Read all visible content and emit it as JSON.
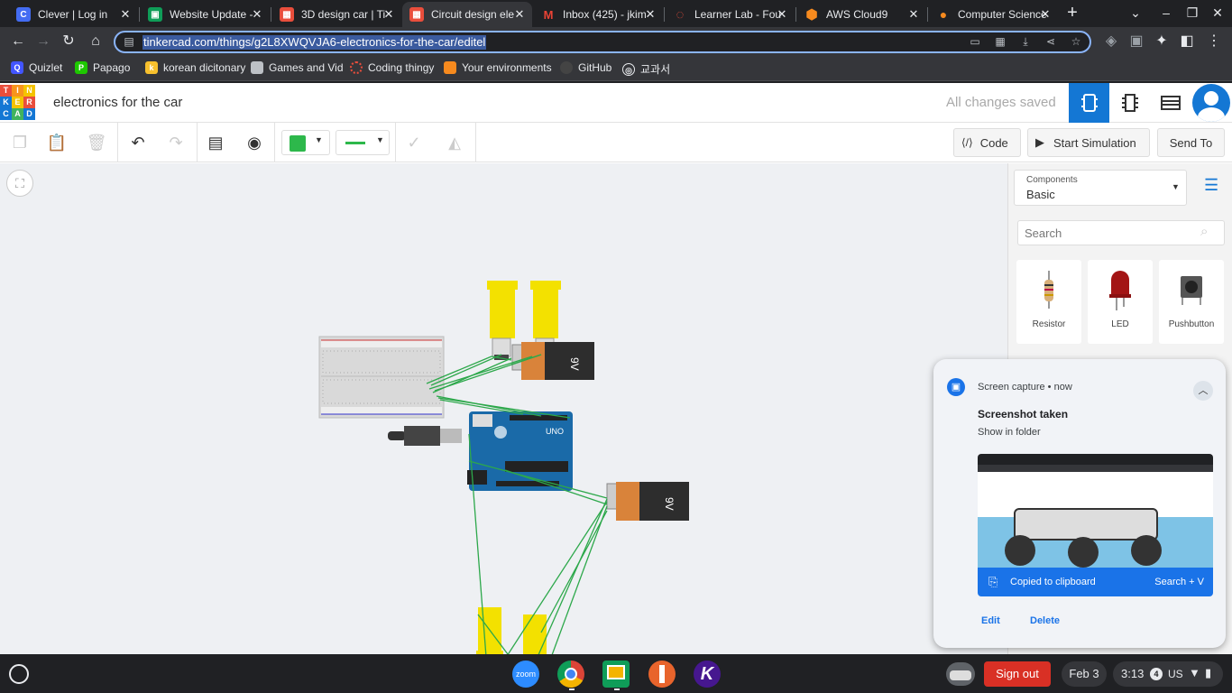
{
  "tabs": [
    {
      "title": "Clever | Log in",
      "fav": "C",
      "color": "#436cf2"
    },
    {
      "title": "Website Update - ",
      "fav": "▣",
      "color": "#0f9d58"
    },
    {
      "title": "3D design car | Ti",
      "fav": "▦",
      "color": "#e94e3c"
    },
    {
      "title": "Circuit design ele",
      "fav": "▦",
      "color": "#e94e3c"
    },
    {
      "title": "Inbox (425) - jkim",
      "fav": "M",
      "color": "#202124"
    },
    {
      "title": "Learner Lab - Fou",
      "fav": "◌",
      "color": "#202124"
    },
    {
      "title": "AWS Cloud9",
      "fav": "⬢",
      "color": "#202124"
    },
    {
      "title": "Computer Science",
      "fav": "●",
      "color": "#202124"
    }
  ],
  "address": {
    "url": "tinkercad.com/things/g2L8XWQVJA6-electronics-for-the-car/editel"
  },
  "bookmarks": [
    "Quizlet",
    "Papago",
    "korean dicitonary",
    "Games and Vid",
    "Coding thingy",
    "Your environments",
    "GitHub",
    "교과서"
  ],
  "app": {
    "logo": [
      "T",
      "I",
      "N",
      "K",
      "E",
      "R",
      "C",
      "A",
      "D"
    ],
    "project_name": "electronics for the car",
    "save_status": "All changes saved",
    "code_label": "Code",
    "start_simulation_label": "Start Simulation",
    "send_to_label": "Send To"
  },
  "panel": {
    "components_label": "Components",
    "components_value": "Basic",
    "search_placeholder": "Search",
    "items": [
      {
        "label": "Resistor"
      },
      {
        "label": "LED"
      },
      {
        "label": "Pushbutton"
      }
    ]
  },
  "canvas": {
    "battery_label": "9V",
    "arduino_label": "UNO"
  },
  "notification": {
    "source": "Screen capture",
    "time": "now",
    "title": "Screenshot taken",
    "subtitle": "Show in folder",
    "clipboard_label": "Copied to clipboard",
    "shortcut": "Search + V",
    "edit_label": "Edit",
    "delete_label": "Delete"
  },
  "shelf": {
    "sign_out_label": "Sign out",
    "date": "Feb 3",
    "time": "3:13",
    "notif_count": "4",
    "ime": "US",
    "apps": [
      "zoom",
      "chrome",
      "classroom",
      "pencil",
      "kahoot"
    ]
  }
}
